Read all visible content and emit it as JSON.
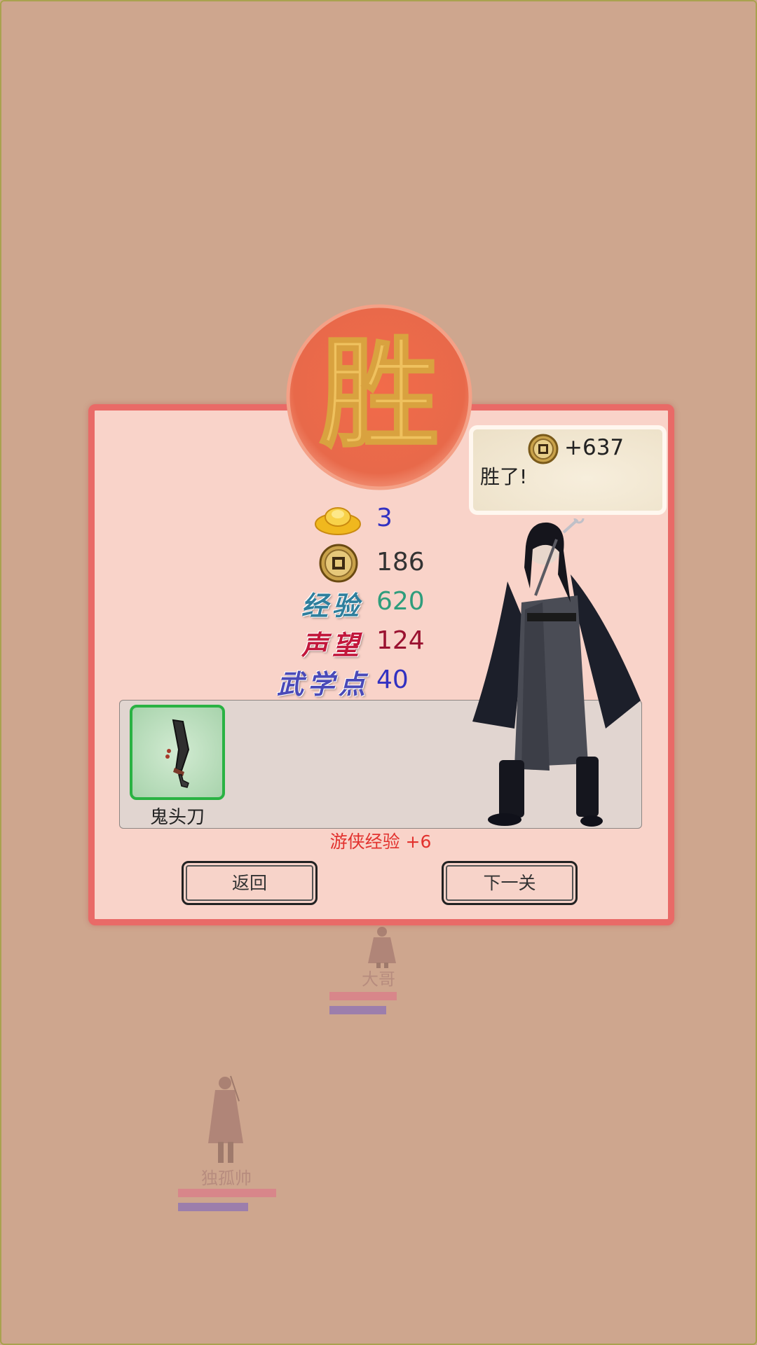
{
  "result": {
    "seal_char": "胜",
    "bubble": {
      "amount": "+637",
      "message": "胜了!"
    },
    "stats": {
      "gold_ingot": "3",
      "coins": "186",
      "exp_label": "经验",
      "exp": "620",
      "fame_label": "声望",
      "fame": "124",
      "martial_label": "武学点",
      "martial": "40"
    },
    "loot": [
      {
        "name": "鬼头刀"
      }
    ],
    "reward_text": "游侠经验 +6",
    "buttons": {
      "back": "返回",
      "next": "下一关"
    }
  },
  "background_units": [
    {
      "name": "大哥",
      "hp": 1.0,
      "mp": 0.85
    },
    {
      "name": "独孤帅",
      "hp": 1.0,
      "mp": 0.71
    }
  ],
  "colors": {
    "background": "#cea68e",
    "panel": "#f9d3c9",
    "panel_border": "#e96a67",
    "stat_blue": "#3231c1",
    "stat_green": "#2f9d7c",
    "stat_red": "#9a1230"
  }
}
